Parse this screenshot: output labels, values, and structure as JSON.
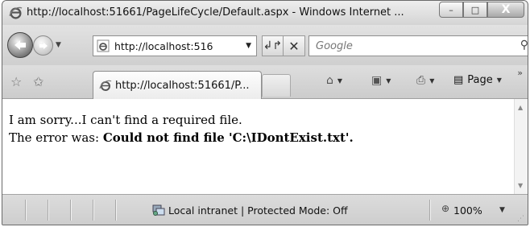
{
  "window": {
    "title": "http://localhost:51661/PageLifeCycle/Default.aspx - Windows Internet ...",
    "caption_min": "–",
    "caption_max": "□",
    "caption_close": "X"
  },
  "nav": {
    "address": "http://localhost:516",
    "search_placeholder": "Google"
  },
  "tab": {
    "label": "http://localhost:51661/P..."
  },
  "commands": {
    "page_label": "Page"
  },
  "content": {
    "line1": "I am sorry...I can't find a required file.",
    "line2_prefix": "The error was: ",
    "line2_error": "Could not find file 'C:\\IDontExist.txt'."
  },
  "status": {
    "zone": "Local intranet | Protected Mode: Off",
    "zoom": "100%"
  }
}
